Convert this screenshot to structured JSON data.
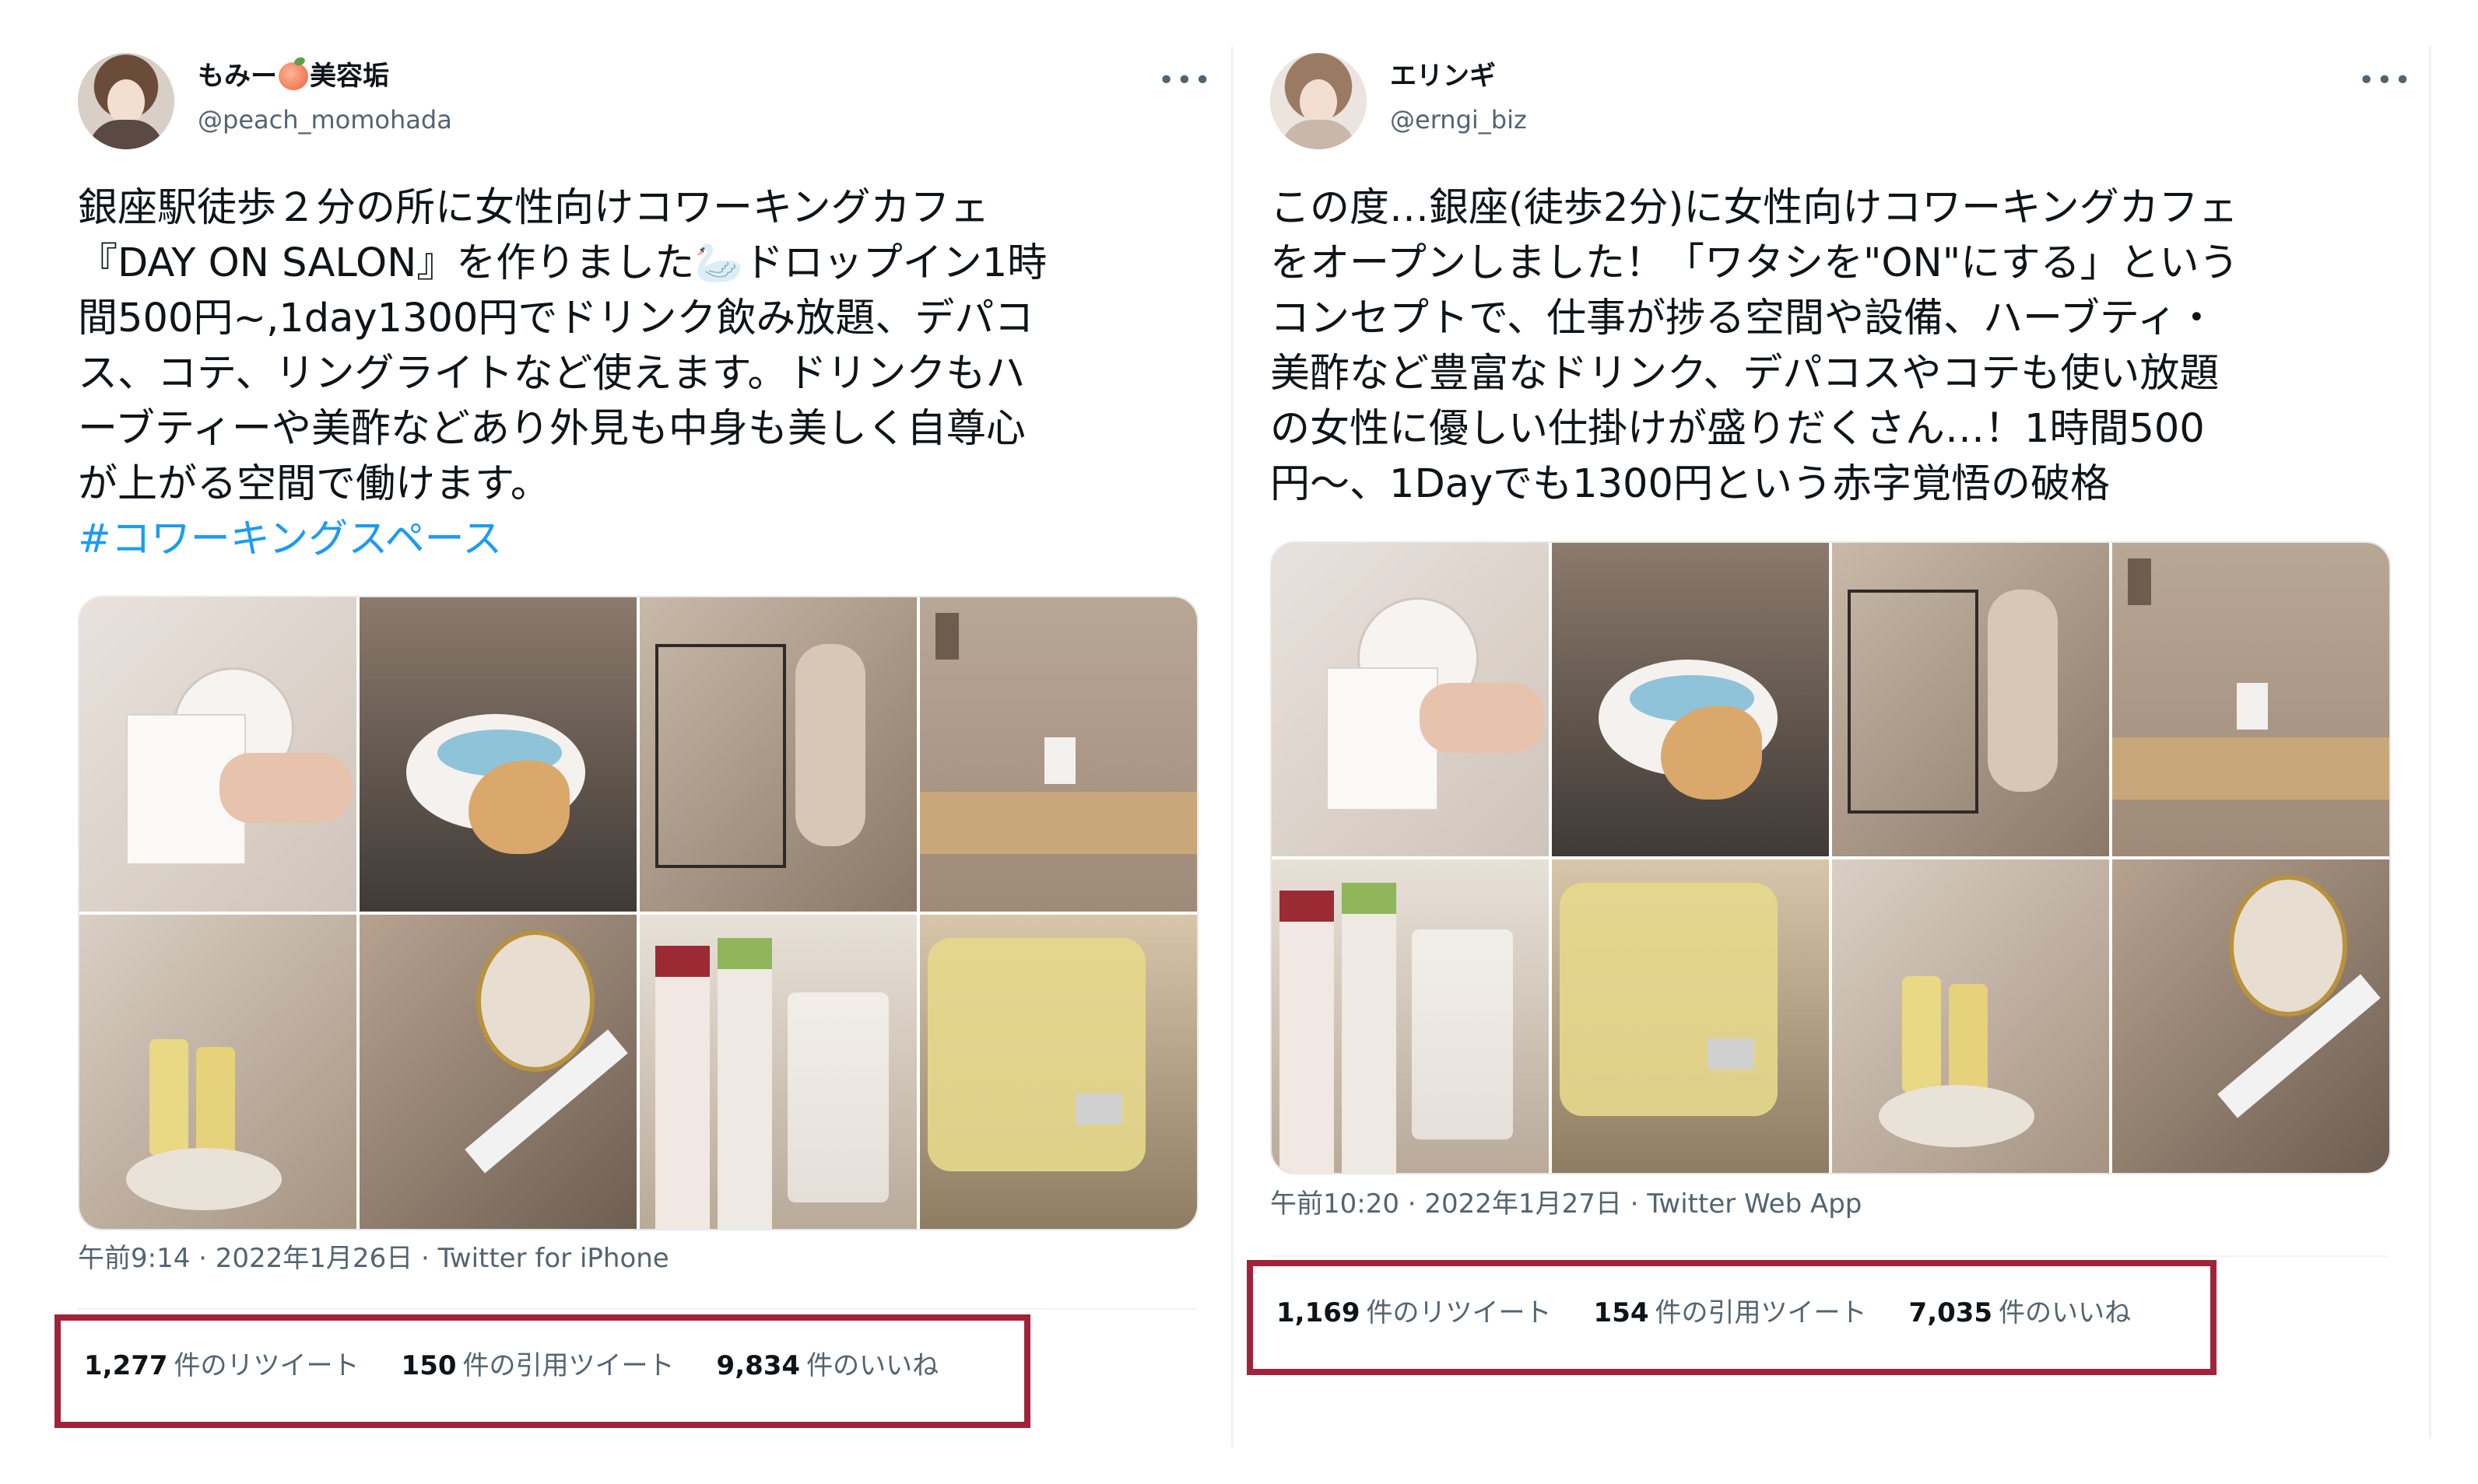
{
  "colors": {
    "highlight": "#a1233a",
    "hashtag": "#1d9bf0",
    "secondary_text": "#536471",
    "primary_text": "#0f1419"
  },
  "tweets": [
    {
      "display_name_prefix": "もみー",
      "display_name_emoji": "peach-emoji",
      "display_name_suffix": "美容垢",
      "handle": "@peach_momohada",
      "more_label": "•••",
      "text": "銀座駅徒歩２分の所に女性向けコワーキングカフェ\n『DAY ON SALON』を作りました🦢ドロップイン1時\n間500円~,1day1300円でドリンク飲み放題、デパコ\nス、コテ、リングライトなど使えます。ドリンクもハ\nーブティーや美酢などあり外見も中身も美しく自尊心\nが上がる空間で働けます。",
      "hashtag": "#コワーキングスペース",
      "timestamp": "午前9:14 · 2022年1月26日 · ",
      "source": "Twitter for iPhone",
      "stats": [
        {
          "num": "1,277",
          "label": "件のリツイート"
        },
        {
          "num": "150",
          "label": "件の引用ツイート"
        },
        {
          "num": "9,834",
          "label": "件のいいね"
        }
      ],
      "media_icons": [
        "salon-card-photo",
        "swan-cookie-tea-photo",
        "cafe-interior-photo",
        "cafe-table-photo",
        "serum-bottles-photo",
        "hair-iron-mirror-photo",
        "drink-bottles-photo",
        "drink-dispenser-photo"
      ]
    },
    {
      "display_name": "エリンギ",
      "handle": "@erngi_biz",
      "more_label": "•••",
      "text": "この度…銀座(徒歩2分)に女性向けコワーキングカフェ\nをオープンしました！「ワタシを\"ON\"にする」という\nコンセプトで、仕事が捗る空間や設備、ハーブティ・\n美酢など豊富なドリンク、デパコスやコテも使い放題\nの女性に優しい仕掛けが盛りだくさん…！1時間500\n円〜、1Dayでも1300円という赤字覚悟の破格",
      "timestamp": "午前10:20 · 2022年1月27日 · ",
      "source": "Twitter Web App",
      "stats": [
        {
          "num": "1,169",
          "label": "件のリツイート"
        },
        {
          "num": "154",
          "label": "件の引用ツイート"
        },
        {
          "num": "7,035",
          "label": "件のいいね"
        }
      ],
      "media_icons": [
        "salon-card-photo",
        "swan-cookie-tea-photo",
        "cafe-interior-photo",
        "cafe-table-photo",
        "drink-bottles-photo",
        "drink-dispenser-photo",
        "serum-bottles-photo",
        "hair-iron-mirror-photo"
      ]
    }
  ]
}
